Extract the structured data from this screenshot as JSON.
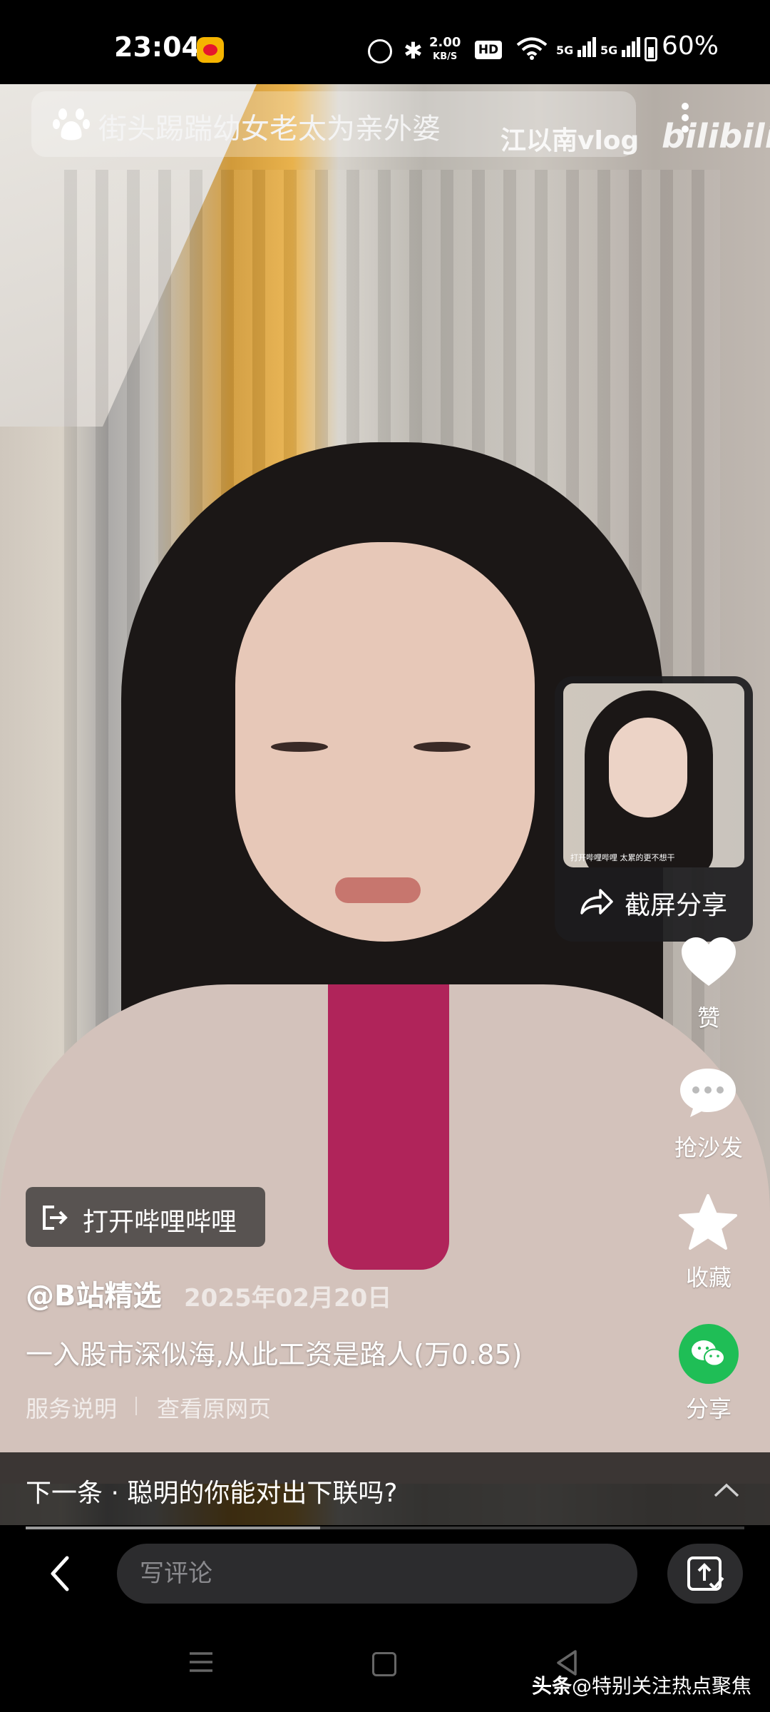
{
  "status_bar": {
    "time": "23:04",
    "net_speed_value": "2.00",
    "net_speed_unit": "KB/S",
    "hd_label": "HD",
    "signal_1": "5G",
    "signal_2": "5G",
    "battery": "60%"
  },
  "top": {
    "search_text": "街头踢踹幼女老太为亲外婆",
    "watermark_text": "江以南vlog",
    "watermark_logo": "bilibili"
  },
  "screenshot_popup": {
    "thumbnail_caption": "打开哔哩哔哩  太累的更不想干",
    "share_label": "截屏分享"
  },
  "rail": {
    "like_label": "赞",
    "comment_label": "抢沙发",
    "favorite_label": "收藏",
    "share_label": "分享"
  },
  "video_info": {
    "open_app_label": "打开哔哩哔哩",
    "author": "@B站精选",
    "date": "2025年02月20日",
    "caption": "一入股市深似海,从此工资是路人(万0.85)",
    "service_link": "服务说明",
    "origin_link": "查看原网页"
  },
  "next": {
    "label": "下一条 · 聪明的你能对出下联吗?"
  },
  "progress": {
    "fraction": 0.41
  },
  "bottom_bar": {
    "comment_placeholder": "写评论"
  },
  "footer": {
    "brand": "头条",
    "handle": "@特别关注热点聚焦"
  }
}
